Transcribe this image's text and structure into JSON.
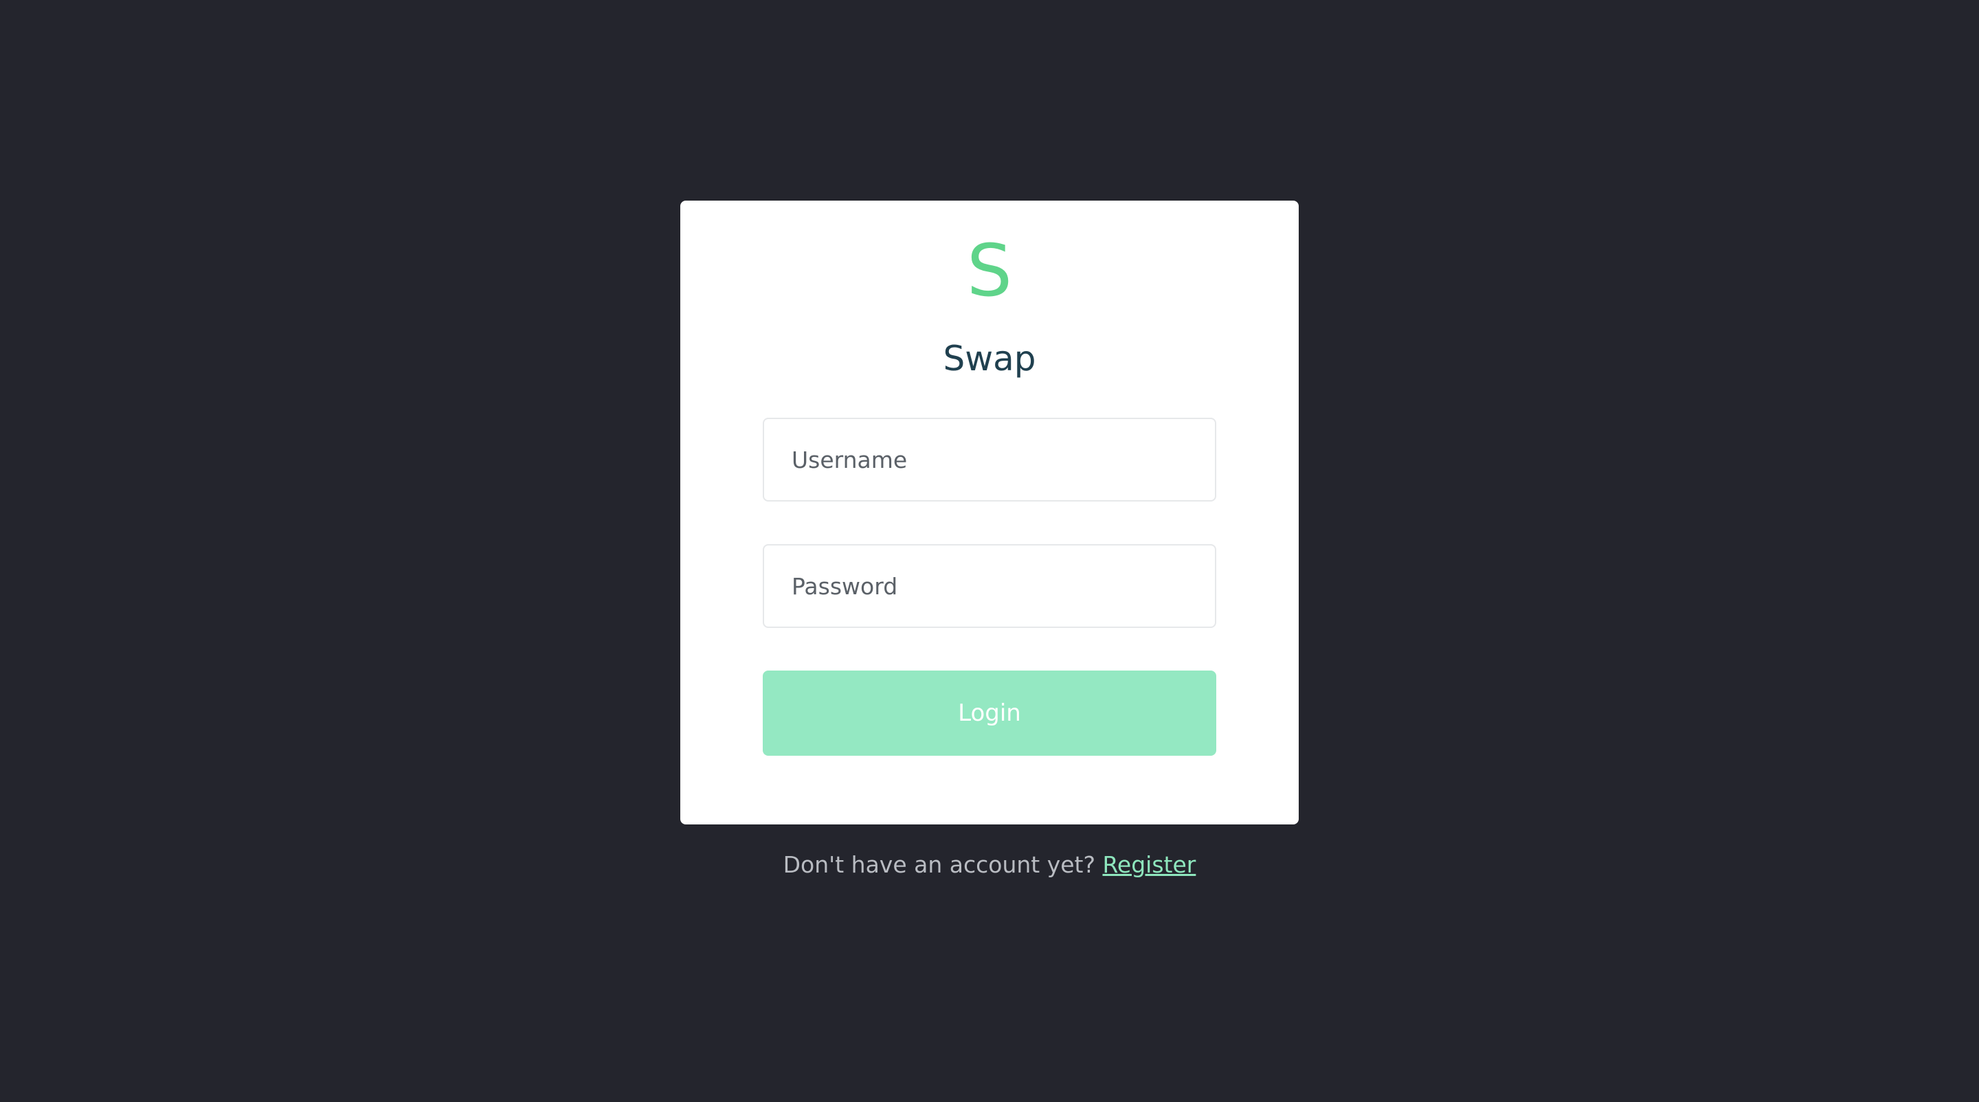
{
  "app": {
    "logo_letter": "S",
    "title": "Swap"
  },
  "form": {
    "username": {
      "value": "",
      "placeholder": "Username"
    },
    "password": {
      "value": "",
      "placeholder": "Password"
    },
    "login_label": "Login"
  },
  "footer": {
    "prompt": "Don't have an account yet?",
    "register_label": "Register"
  },
  "colors": {
    "background": "#24252d",
    "card": "#ffffff",
    "accent": "#5fd48a",
    "button": "#94e8c2",
    "title": "#20404f",
    "link": "#8ee6bd"
  }
}
